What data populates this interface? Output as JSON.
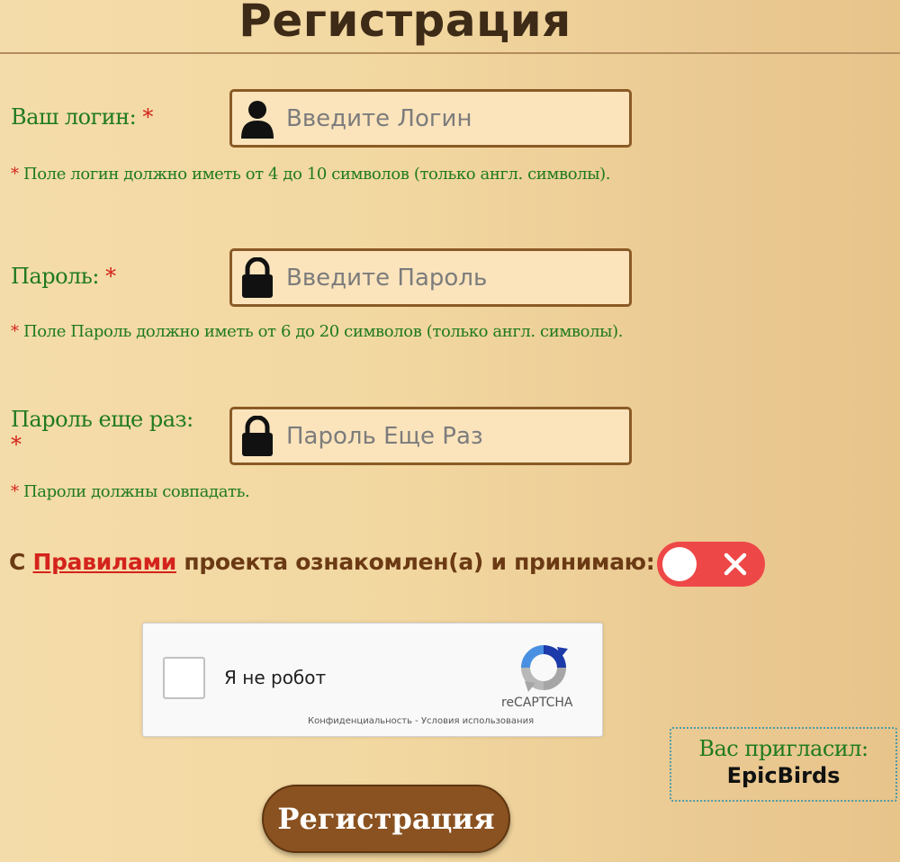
{
  "page": {
    "title": "Регистрация"
  },
  "login": {
    "label": "Ваш логин:",
    "required_mark": "*",
    "placeholder": "Введите Логин",
    "value": "",
    "hint_mark": "*",
    "hint": "Поле логин должно иметь от 4 до 10 символов (только англ. символы)."
  },
  "password": {
    "label": "Пароль:",
    "required_mark": "*",
    "placeholder": "Введите Пароль",
    "value": "",
    "hint_mark": "*",
    "hint": "Поле Пароль должно иметь от 6 до 20 символов (только англ. символы)."
  },
  "password_repeat": {
    "label": "Пароль еще раз:",
    "required_mark": "*",
    "placeholder": "Пароль Еще Раз",
    "value": "",
    "hint_mark": "*",
    "hint": "Пароли должны совпадать."
  },
  "rules": {
    "prefix": "С",
    "link": "Правилами",
    "suffix": "проекта ознакомлен(а) и принимаю:",
    "accepted": false
  },
  "captcha": {
    "label": "Я не робот",
    "brand": "reCAPTCHA",
    "links": "Конфиденциальность - Условия использования"
  },
  "invited": {
    "label": "Вас пригласил:",
    "name": "EpicBirds"
  },
  "submit": {
    "label": "Регистрация"
  },
  "colors": {
    "accent": "#8a5220",
    "label_green": "#1f7a1f",
    "required_red": "#d4231c",
    "toggle_off": "#ee4747"
  },
  "icons": {
    "login": "user-icon",
    "password": "lock-icon",
    "toggle": "close-icon",
    "captcha": "recaptcha-icon"
  }
}
